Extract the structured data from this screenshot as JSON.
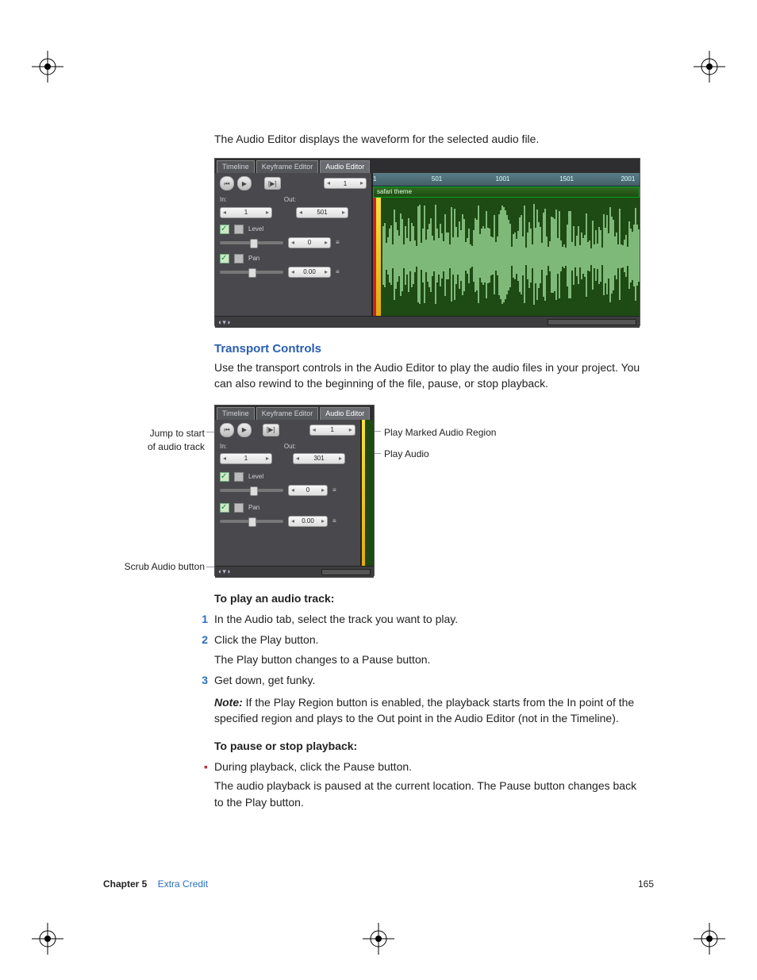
{
  "intro_text": "The Audio Editor displays the waveform for the selected audio file.",
  "editor": {
    "tabs": [
      "Timeline",
      "Keyframe Editor",
      "Audio Editor"
    ],
    "active_tab": 2,
    "frame_field": "1",
    "in_label": "In:",
    "out_label": "Out:",
    "in_value": "1",
    "out_value_big": "501",
    "out_value_small": "301",
    "level_label": "Level",
    "level_value": "0",
    "pan_label": "Pan",
    "pan_value": "0.00",
    "track_name": "safari theme",
    "ruler_ticks": [
      "1",
      "501",
      "1001",
      "1501",
      "2001"
    ],
    "scrub_icons": "◐▾◑"
  },
  "section_title": "Transport Controls",
  "section_body": "Use the transport controls in the Audio Editor to play the audio files in your project. You can also rewind to the beginning of the file, pause, or stop playback.",
  "callouts": {
    "left1_a": "Jump to start",
    "left1_b": "of audio track",
    "left2": "Scrub Audio button",
    "right1": "Play Marked Audio Region",
    "right2": "Play Audio"
  },
  "task1_head": "To play an audio track:",
  "steps": [
    "In the Audio tab, select the track you want to play.",
    "Click the Play button.",
    "Get down, get funky."
  ],
  "after_step2": "The Play button changes to a Pause button.",
  "note_label": "Note:",
  "note_body": "  If the Play Region button is enabled, the playback starts from the In point of the specified region and plays to the Out point in the Audio Editor (not in the Timeline).",
  "task2_head": "To pause or stop playback:",
  "bullet1": "During playback, click the Pause button.",
  "bullet1_after": "The audio playback is paused at the current location. The Pause button changes back to the Play button.",
  "footer": {
    "chapter": "Chapter 5",
    "title": "Extra Credit",
    "page": "165"
  }
}
